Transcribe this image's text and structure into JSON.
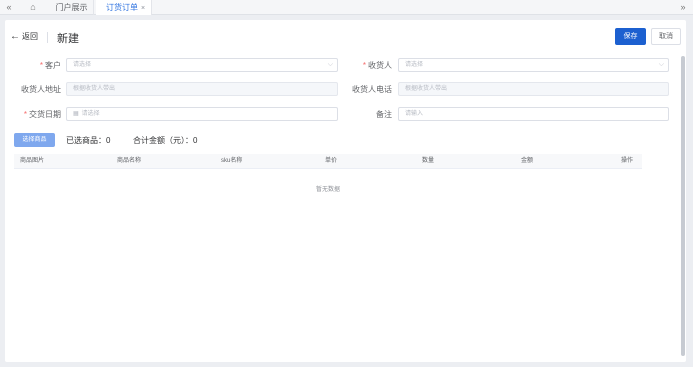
{
  "tabs": {
    "prev": "«",
    "home_icon": "⌂",
    "items": [
      {
        "label": "门户展示",
        "active": false
      },
      {
        "label": "订货订单",
        "active": true
      }
    ],
    "close": "×",
    "next": "»"
  },
  "header": {
    "back_label": "返回",
    "title": "新建",
    "save_label": "保存",
    "cancel_label": "取消"
  },
  "form": {
    "customer": {
      "label": "客户",
      "placeholder": "请选择",
      "required": true
    },
    "receiver": {
      "label": "收货人",
      "placeholder": "请选择",
      "required": true
    },
    "receiver_address": {
      "label": "收货人地址",
      "placeholder": "根据收货人带出"
    },
    "receiver_phone": {
      "label": "收货人电话",
      "placeholder": "根据收货人带出"
    },
    "delivery_date": {
      "label": "交货日期",
      "placeholder": "请选择",
      "required": true
    },
    "remark": {
      "label": "备注",
      "placeholder": "请输入"
    }
  },
  "products": {
    "select_button": "选择商品",
    "selected_count": "已选商品：0",
    "total_amount": "合计金额（元）：0",
    "columns": [
      "商品图片",
      "商品名称",
      "sku名称",
      "单价",
      "数量",
      "金额",
      "操作"
    ],
    "empty_text": "暂无数据"
  },
  "colors": {
    "primary": "#1c60d0",
    "active_tab": "#2f73e0",
    "required": "#f56c6c"
  }
}
